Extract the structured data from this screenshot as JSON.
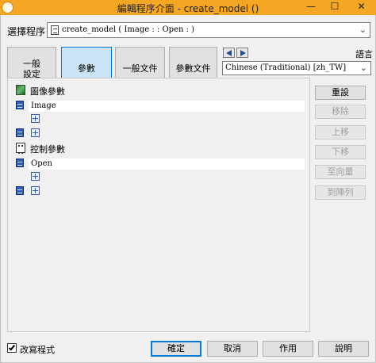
{
  "window": {
    "title": "編輯程序介面 - create_model ()",
    "title_bar_color": "#f5a623",
    "minimize": "—",
    "maximize": "☐",
    "close": "✕"
  },
  "procedure": {
    "label": "選擇程序",
    "value": "create_model ( Image : : Open : )"
  },
  "tabs": [
    {
      "label": "一般\n設定",
      "active": false
    },
    {
      "label": "參數",
      "active": true
    },
    {
      "label": "一般文件",
      "active": false
    },
    {
      "label": "參數文件",
      "active": false
    }
  ],
  "language": {
    "label": "語言",
    "value": "Chinese (Traditional) [zh_TW]",
    "prev_icon": "arrow-left-icon",
    "next_icon": "arrow-right-icon"
  },
  "sections": {
    "image": {
      "label": "圖像參數",
      "icon": "image-params-icon",
      "param": "Image"
    },
    "control": {
      "label": "控制參數",
      "icon": "control-params-icon",
      "param": "Open"
    }
  },
  "side_buttons": {
    "reset": "重設",
    "remove": "移除",
    "up": "上移",
    "down": "下移",
    "to_vector": "至向量",
    "to_tuple": "到陣列"
  },
  "footer": {
    "modify_label": "改寫程式",
    "modify_checked": true,
    "ok": "確定",
    "cancel": "取消",
    "apply": "作用",
    "help": "說明"
  },
  "colors": {
    "active_tab": "#cce4f7",
    "active_border": "#0078d7",
    "param_icon": "#2f5fb5"
  }
}
